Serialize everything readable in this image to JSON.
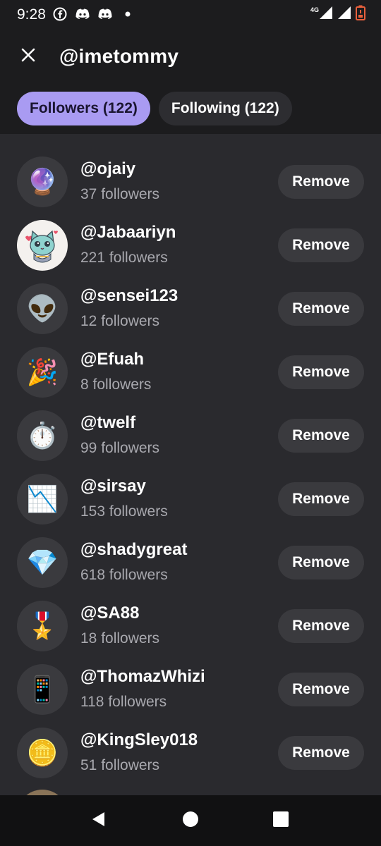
{
  "status_bar": {
    "time": "9:28",
    "left_icons": [
      "facebook-icon",
      "discord-icon",
      "discord-icon",
      "dot-icon"
    ],
    "network_label": "4G",
    "battery_color": "#e8603c"
  },
  "header": {
    "title": "@imetommy"
  },
  "tabs": [
    {
      "label": "Followers (122)",
      "active": true
    },
    {
      "label": "Following (122)",
      "active": false
    }
  ],
  "colors": {
    "accent": "#a99bf2",
    "background": "#2a2a2e",
    "header_background": "#1c1c1e",
    "button_background": "#3a3a3e",
    "muted_text": "#a8a8ae"
  },
  "followers": [
    {
      "username": "@ojaiy",
      "followers": "37 followers",
      "avatar_icon": "crystal-ball-icon",
      "avatar_glyph": "🔮",
      "action": "Remove"
    },
    {
      "username": "@Jabaariyn",
      "followers": "221 followers",
      "avatar_icon": "cat-illustration-icon",
      "avatar_glyph": "",
      "action": "Remove"
    },
    {
      "username": "@sensei123",
      "followers": "12 followers",
      "avatar_icon": "alien-icon",
      "avatar_glyph": "👽",
      "action": "Remove"
    },
    {
      "username": "@Efuah",
      "followers": "8 followers",
      "avatar_icon": "party-popper-icon",
      "avatar_glyph": "🎉",
      "action": "Remove"
    },
    {
      "username": "@twelf",
      "followers": "99 followers",
      "avatar_icon": "stopwatch-icon",
      "avatar_glyph": "⏱️",
      "action": "Remove"
    },
    {
      "username": "@sirsay",
      "followers": "153 followers",
      "avatar_icon": "chart-decreasing-icon",
      "avatar_glyph": "📉",
      "action": "Remove"
    },
    {
      "username": "@shadygreat",
      "followers": "618 followers",
      "avatar_icon": "gem-icon",
      "avatar_glyph": "💎",
      "action": "Remove"
    },
    {
      "username": "@SA88",
      "followers": "18 followers",
      "avatar_icon": "military-medal-icon",
      "avatar_glyph": "🎖️",
      "action": "Remove"
    },
    {
      "username": "@ThomazWhizi",
      "followers": "118 followers",
      "avatar_icon": "mobile-phone-icon",
      "avatar_glyph": "📱",
      "action": "Remove"
    },
    {
      "username": "@KingSley018",
      "followers": "51 followers",
      "avatar_icon": "coin-icon",
      "avatar_glyph": "🪙",
      "action": "Remove"
    }
  ],
  "nav_bar": {
    "buttons": [
      "back-icon",
      "home-icon",
      "recents-icon"
    ]
  }
}
